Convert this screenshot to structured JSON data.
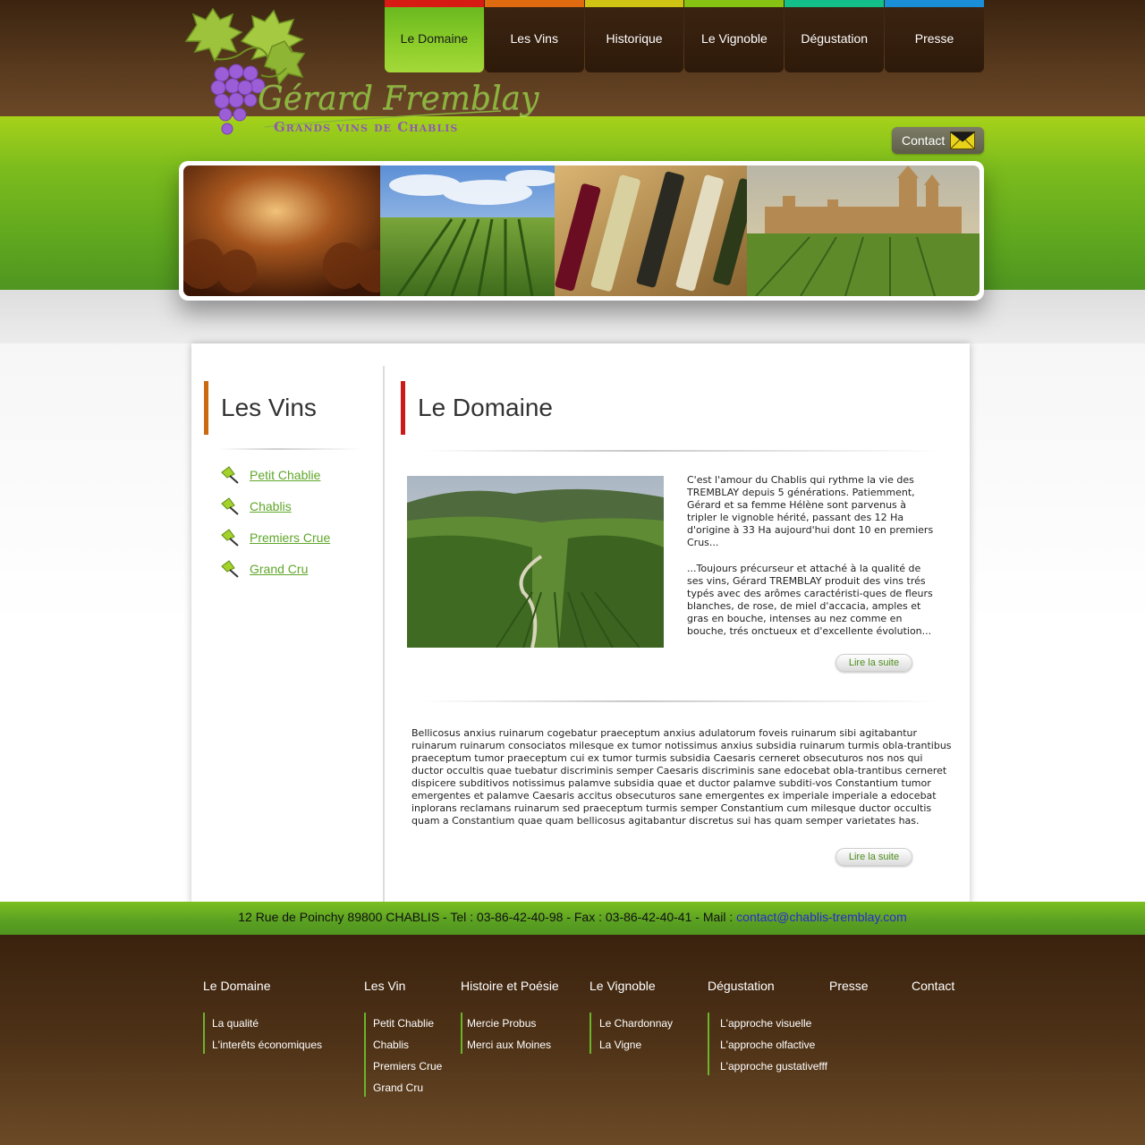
{
  "brand": {
    "name": "Gérard Fremblay",
    "tagline": "Grands vins de Chablis"
  },
  "nav": {
    "items": [
      {
        "label": "Le Domaine",
        "color": "#d81a14",
        "active": true
      },
      {
        "label": "Les Vins",
        "color": "#e06a10",
        "active": false
      },
      {
        "label": "Historique",
        "color": "#cfc413",
        "active": false
      },
      {
        "label": "Le Vignoble",
        "color": "#86c312",
        "active": false
      },
      {
        "label": "Dégustation",
        "color": "#14c08a",
        "active": false
      },
      {
        "label": "Presse",
        "color": "#1a8fd8",
        "active": false
      }
    ]
  },
  "contact_button": {
    "label": "Contact",
    "icon": "envelope-icon"
  },
  "sidebar": {
    "title": "Les Vins",
    "items": [
      {
        "label": "Petit Chablie"
      },
      {
        "label": "Chablis"
      },
      {
        "label": "Premiers Crue"
      },
      {
        "label": "Grand Cru"
      }
    ]
  },
  "content": {
    "title": "Le Domaine",
    "intro_p1": "C'est l'amour du Chablis qui rythme la vie des TREMBLAY depuis 5 générations. Patiemment, Gérard et sa femme Hélène sont parvenus à tripler le vignoble hérité, passant des 12 Ha d'origine à 33 Ha aujourd'hui dont 10 en premiers Crus...",
    "intro_p2": "...Toujours précurseur et attaché à la qualité de ses vins, Gérard TREMBLAY  produit des vins trés typés avec des arômes caractéristi-ques de fleurs blanches, de rose, de miel d'accacia, amples et gras en bouche, intenses au nez comme en bouche,  trés onctueux et d'excellente évolution...",
    "more_label_1": "Lire la suite",
    "body": "Bellicosus anxius ruinarum cogebatur praeceptum anxius adulatorum foveis ruinarum sibi agitabantur ruinarum ruinarum consociatos milesque ex tumor notissimus anxius subsidia ruinarum turmis obla-trantibus praeceptum tumor praeceptum cui ex tumor turmis subsidia Caesaris cerneret obsecuturos nos nos qui ductor occultis quae tuebatur discriminis semper Caesaris discriminis sane edocebat obla-trantibus cerneret dispicere subditivos notissimus palamve subsidia quae et ductor palamve subditi-vos Constantium tumor emergentes et palamve Caesaris accitus obsecuturos sane emergentes ex imperiale imperiale a edocebat inplorans reclamans ruinarum sed praeceptum turmis semper Constantium cum milesque ductor occultis quam a Constantium quae quam bellicosus agitabantur discretus sui has quam semper varietates has.",
    "more_label_2": "Lire la suite"
  },
  "address": {
    "text": "12 Rue de Poinchy 89800 CHABLIS - Tel : 03-86-42-40-98 - Fax : 03-86-42-40-41 - Mail : ",
    "email": "contact@chablis-tremblay.com"
  },
  "footer": {
    "columns": [
      {
        "heading": "Le Domaine",
        "links": [
          "La qualité",
          "L'interêts économiques"
        ]
      },
      {
        "heading": "Les Vin",
        "links": [
          "Petit Chablie",
          "Chablis",
          "Premiers Crue",
          "Grand Cru"
        ]
      },
      {
        "heading": "Histoire et Poésie",
        "links": [
          "Mercie Probus",
          "Merci aux Moines"
        ]
      },
      {
        "heading": "Le Vignoble",
        "links": [
          "Le Chardonnay",
          "La Vigne"
        ]
      },
      {
        "heading": "Dégustation",
        "links": [
          "L'approche visuelle",
          "L'approche olfactive",
          "L'approche  gustativefff"
        ]
      },
      {
        "heading": "Presse",
        "links": []
      },
      {
        "heading": "Contact",
        "links": []
      }
    ]
  }
}
